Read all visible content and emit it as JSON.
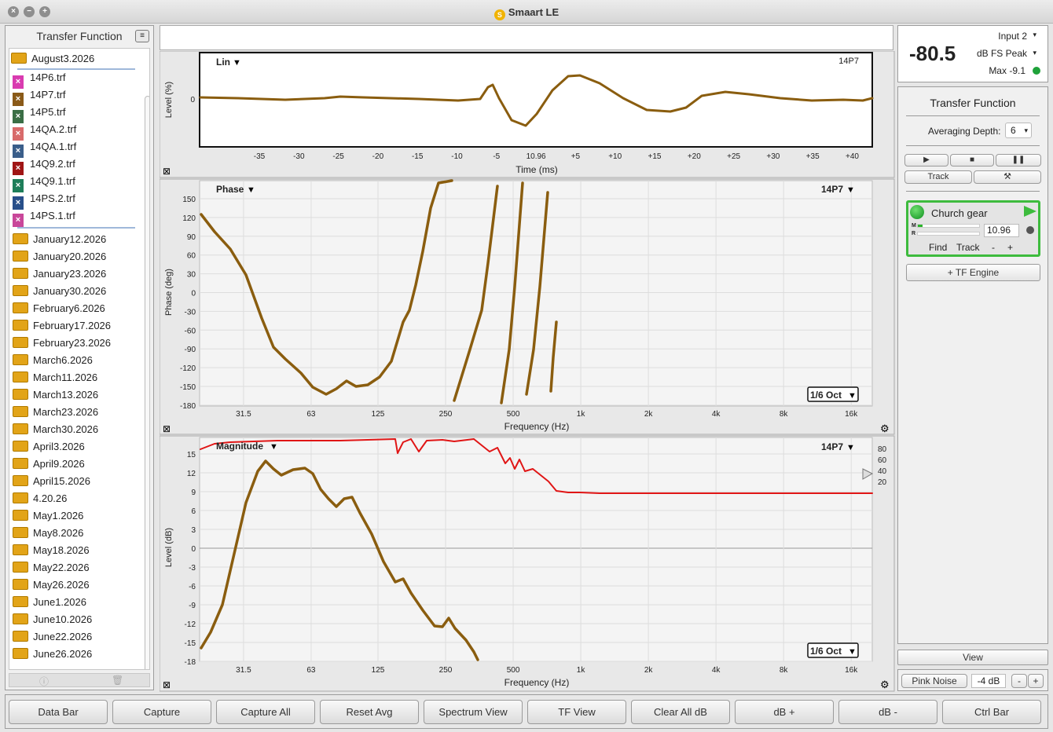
{
  "app": {
    "title": "Smaart LE"
  },
  "sidebar": {
    "header": "Transfer Function",
    "folder_open": "August3.2026",
    "files": [
      {
        "name": "14P6.trf",
        "color": "#d93bb0"
      },
      {
        "name": "14P7.trf",
        "color": "#8a5a18"
      },
      {
        "name": "14P5.trf",
        "color": "#3a6e45"
      },
      {
        "name": "14QA.2.trf",
        "color": "#d86b6b"
      },
      {
        "name": "14QA.1.trf",
        "color": "#3a5e8a"
      },
      {
        "name": "14Q9.2.trf",
        "color": "#a01515"
      },
      {
        "name": "14Q9.1.trf",
        "color": "#1e7e5a"
      },
      {
        "name": "14PS.2.trf",
        "color": "#284f8a"
      },
      {
        "name": "14PS.1.trf",
        "color": "#c9479a"
      }
    ],
    "folders": [
      "January12.2026",
      "January20.2026",
      "January23.2026",
      "January30.2026",
      "February6.2026",
      "February17.2026",
      "February23.2026",
      "March6.2026",
      "March11.2026",
      "March13.2026",
      "March23.2026",
      "March30.2026",
      "April3.2026",
      "April9.2026",
      "April15.2026",
      "4.20.26",
      "May1.2026",
      "May8.2026",
      "May18.2026",
      "May22.2026",
      "May26.2026",
      "June1.2026",
      "June10.2026",
      "June22.2026",
      "June26.2026"
    ]
  },
  "graphs": {
    "impulse": {
      "mode": "Lin",
      "trace": "14P7",
      "ylabel": "Level (%)",
      "xlabel": "Time (ms)",
      "y_ticks": [
        "0"
      ],
      "x_ticks": [
        "-35",
        "-30",
        "-25",
        "-20",
        "-15",
        "-10",
        "-5",
        "10.96",
        "+5",
        "+10",
        "+15",
        "+20",
        "+25",
        "+30",
        "+35",
        "+40"
      ]
    },
    "phase": {
      "mode": "Phase",
      "trace": "14P7",
      "ylabel": "Phase (deg)",
      "xlabel": "Frequency (Hz)",
      "smoothing": "1/6 Oct",
      "y_ticks": [
        "150",
        "120",
        "90",
        "60",
        "30",
        "0",
        "-30",
        "-60",
        "-90",
        "-120",
        "-150",
        "-180"
      ],
      "x_ticks": [
        "31.5",
        "63",
        "125",
        "250",
        "500",
        "1k",
        "2k",
        "4k",
        "8k",
        "16k"
      ]
    },
    "magnitude": {
      "mode": "Magnitude",
      "trace": "14P7",
      "ylabel": "Level (dB)",
      "xlabel": "Frequency (Hz)",
      "smoothing": "1/6 Oct",
      "y_ticks": [
        "15",
        "12",
        "9",
        "6",
        "3",
        "0",
        "-3",
        "-6",
        "-9",
        "-12",
        "-15",
        "-18"
      ],
      "x_ticks": [
        "31.5",
        "63",
        "125",
        "250",
        "500",
        "1k",
        "2k",
        "4k",
        "8k",
        "16k"
      ],
      "coherence_ticks": [
        "80",
        "60",
        "40",
        "20"
      ]
    }
  },
  "meter": {
    "input": "Input 2",
    "value": "-80.5",
    "unit": "dB FS Peak",
    "max": "Max -9.1"
  },
  "tf_panel": {
    "title": "Transfer Function",
    "averaging_label": "Averaging Depth:",
    "averaging_value": "6",
    "track_label": "Track",
    "engine": {
      "name": "Church gear",
      "m_label": "M",
      "r_label": "R",
      "delay": "10.96",
      "find": "Find",
      "track": "Track",
      "minus": "-",
      "plus": "+"
    },
    "add_engine": "+ TF Engine",
    "view": "View"
  },
  "generator": {
    "label": "Pink Noise",
    "level": "-4 dB",
    "minus": "-",
    "plus": "+"
  },
  "toolbar": [
    "Data Bar",
    "Capture",
    "Capture All",
    "Reset Avg",
    "Spectrum View",
    "TF View",
    "Clear All dB",
    "dB +",
    "dB -",
    "Ctrl Bar"
  ]
}
